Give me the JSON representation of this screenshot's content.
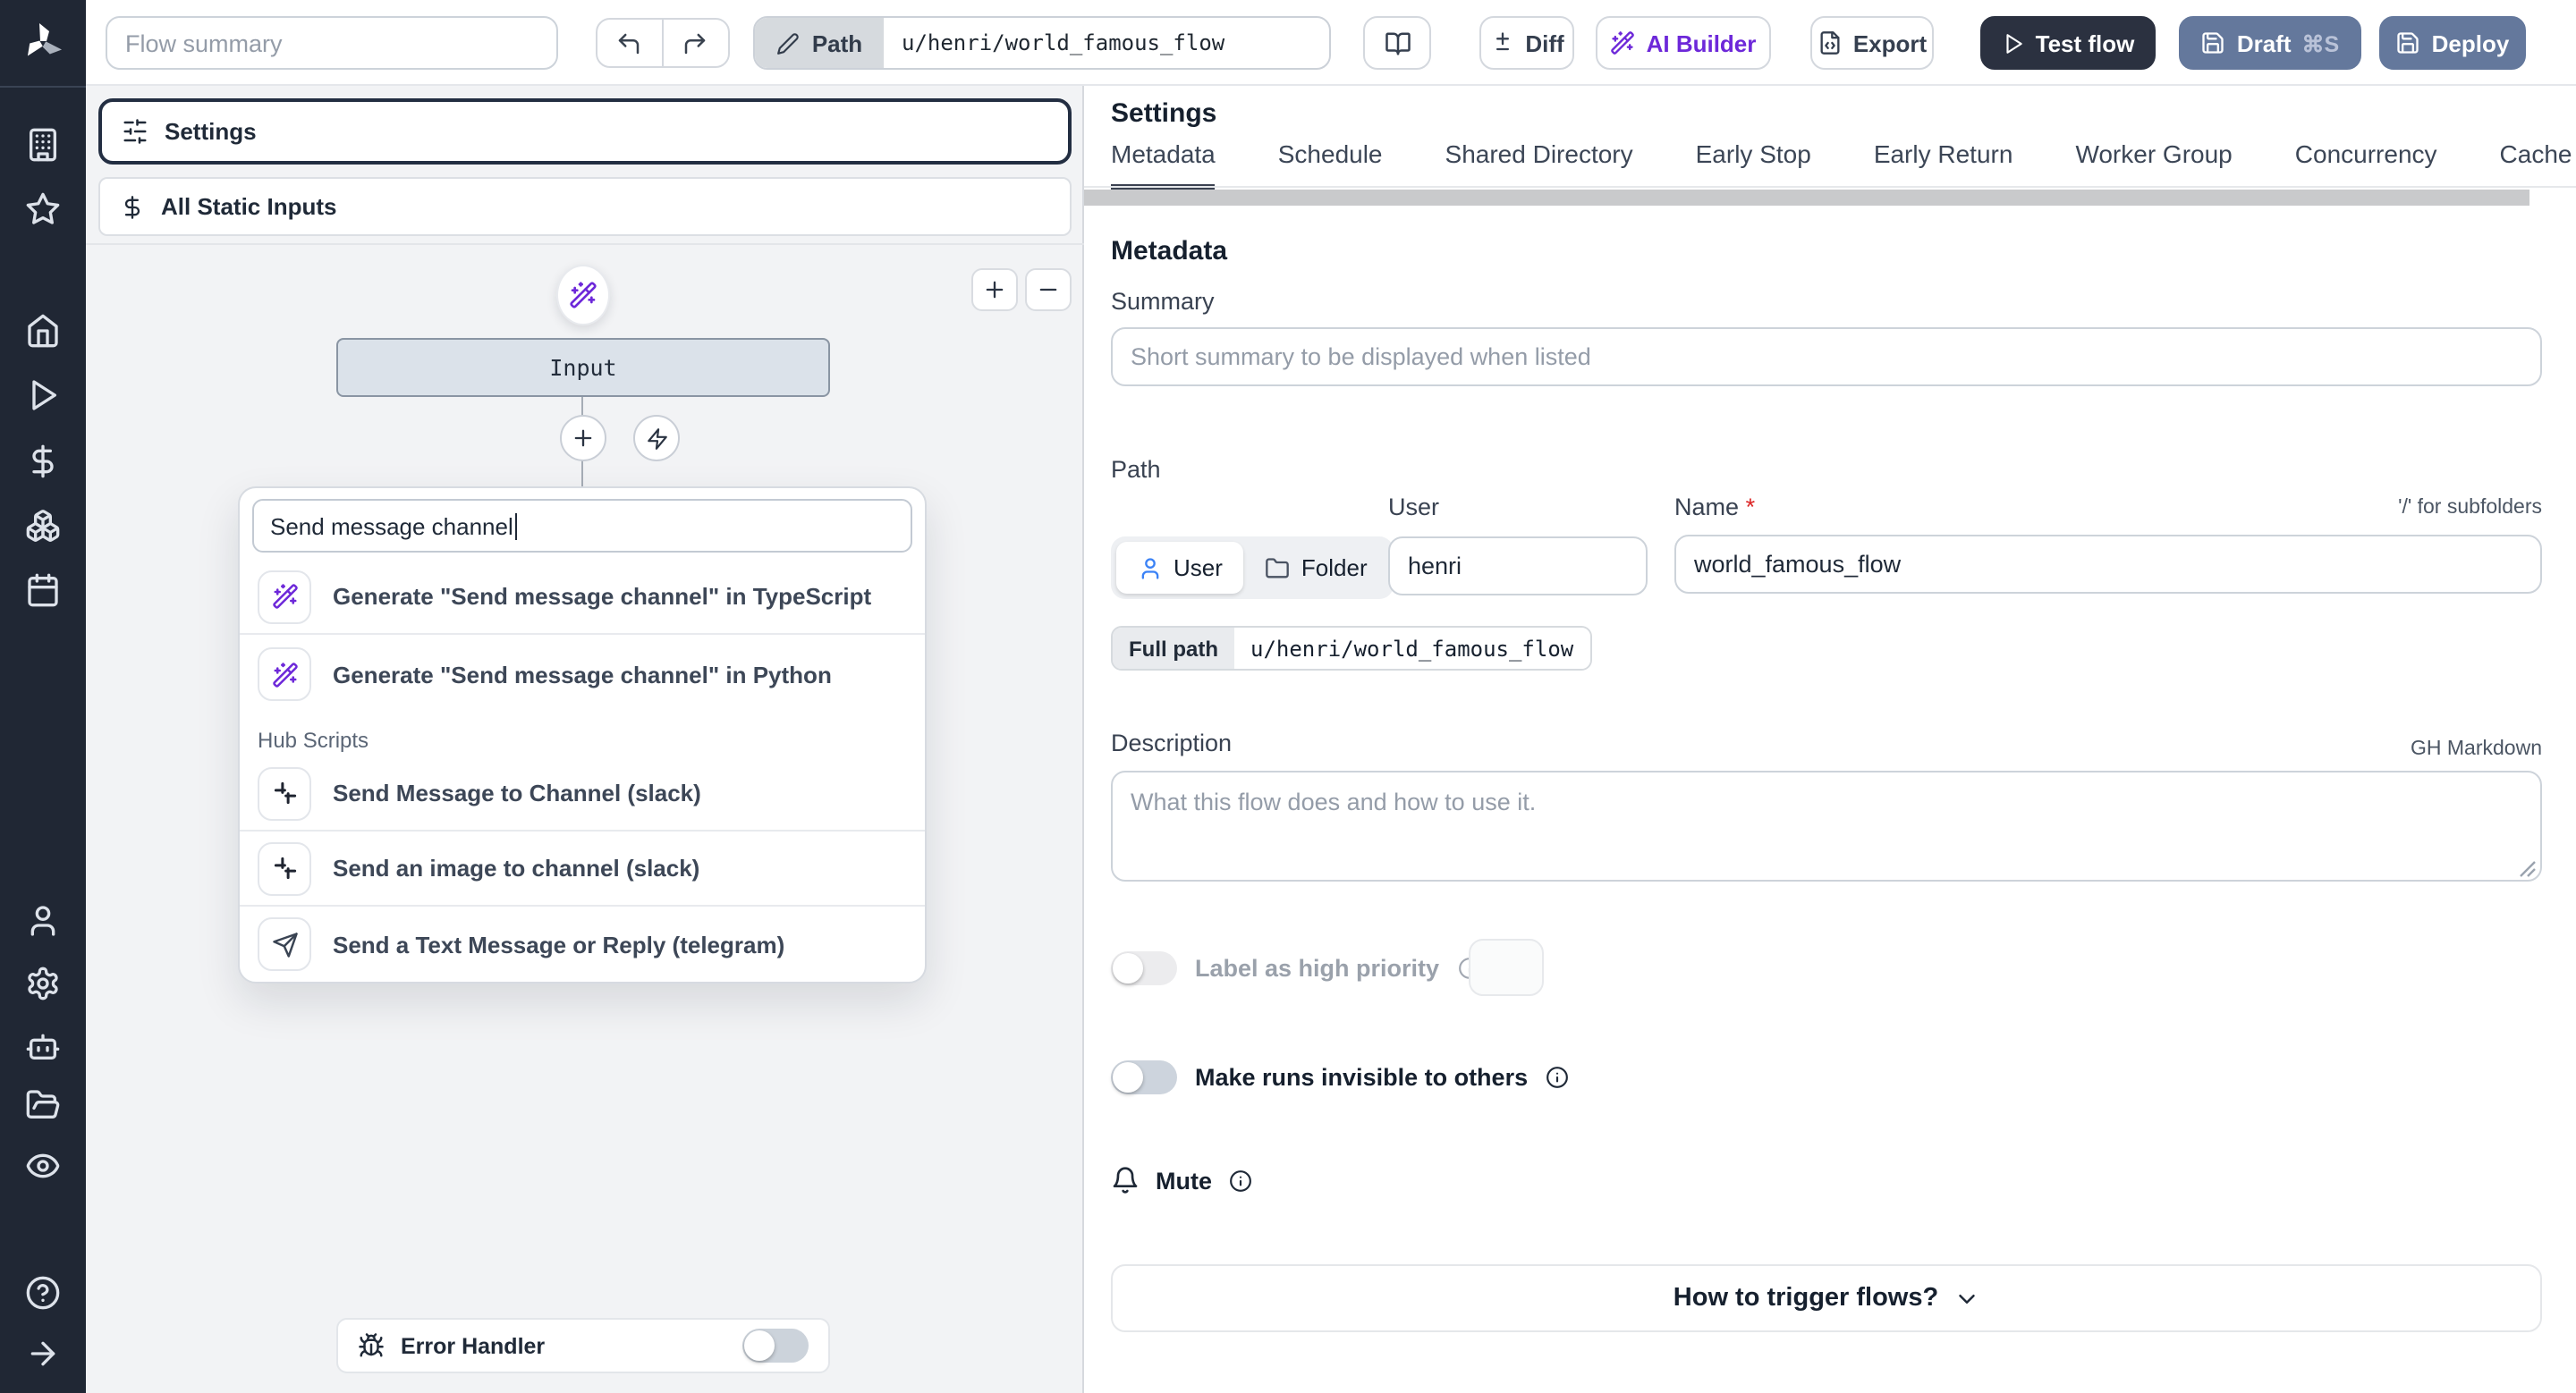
{
  "topbar": {
    "flow_summary_placeholder": "Flow summary",
    "path_button": "Path",
    "path_value": "u/henri/world_famous_flow",
    "diff": "Diff",
    "ai_builder": "AI Builder",
    "export": "Export",
    "test_flow": "Test flow",
    "draft": "Draft",
    "draft_shortcut": "⌘S",
    "deploy": "Deploy"
  },
  "flow": {
    "settings": "Settings",
    "all_static_inputs": "All Static Inputs",
    "input_node": "Input",
    "search_value": "Send message channel",
    "generate_ts": "Generate \"Send message channel\" in TypeScript",
    "generate_py": "Generate \"Send message channel\" in Python",
    "hub_scripts_label": "Hub Scripts",
    "hub_item_1": "Send Message to Channel (slack)",
    "hub_item_2": "Send an image to channel (slack)",
    "hub_item_3": "Send a Text Message or Reply (telegram)",
    "error_handler": "Error Handler"
  },
  "settings": {
    "title": "Settings",
    "tabs": [
      "Metadata",
      "Schedule",
      "Shared Directory",
      "Early Stop",
      "Early Return",
      "Worker Group",
      "Concurrency",
      "Cache"
    ],
    "active_tab": "Metadata",
    "heading": "Metadata",
    "summary_label": "Summary",
    "summary_placeholder": "Short summary to be displayed when listed",
    "path_label": "Path",
    "user_toggle": "User",
    "folder_toggle": "Folder",
    "user_label": "User",
    "user_value": "henri",
    "name_label": "Name",
    "required_mark": "*",
    "subfolders_hint": "'/' for subfolders",
    "name_value": "world_famous_flow",
    "full_path_label": "Full path",
    "full_path_value": "u/henri/world_famous_flow",
    "description_label": "Description",
    "gh_markdown": "GH Markdown",
    "description_placeholder": "What this flow does and how to use it.",
    "high_priority_label": "Label as high priority",
    "invisible_runs_label": "Make runs invisible to others",
    "mute_label": "Mute",
    "trigger_help": "How to trigger flows?"
  },
  "colors": {
    "sidebar_bg": "#202734",
    "accent_purple": "#6d28d9",
    "dark_button": "#2b3140",
    "slate_button": "#64789c",
    "flow_bg": "#f2f3f5",
    "node_fill": "#dbe2ea"
  }
}
